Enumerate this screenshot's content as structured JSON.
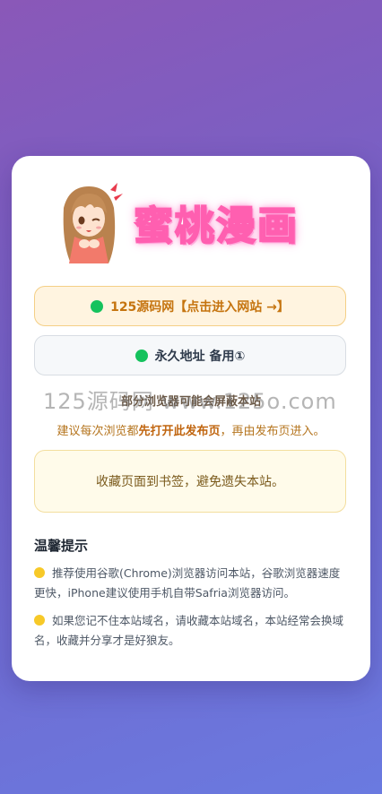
{
  "logo": {
    "title": "蜜桃漫画",
    "mascot_icon": "anime-girl-mascot-icon"
  },
  "buttons": {
    "primary_label": "125源码网【点击进入网站 →】",
    "secondary_label": "永久地址 备用①",
    "status_dot_color": "#15c25d"
  },
  "notice": {
    "line1": "部分浏览器可能会屏蔽本站",
    "line2_prefix": "建议每次浏览都",
    "line2_strong": "先打开此发布页",
    "line2_suffix": "，再由发布页进入。"
  },
  "bookmark_text": "收藏页面到书签，避免遗失本站。",
  "tips": {
    "title": "温馨提示",
    "items": [
      "推荐使用谷歌(Chrome)浏览器访问本站，谷歌浏览器速度更快，iPhone建议使用手机自带Safria浏览器访问。",
      "如果您记不住本站域名，请收藏本站域名，本站经常会换域名，收藏并分享才是好狼友。"
    ]
  },
  "watermark": "125源码网 www.125o.com",
  "colors": {
    "accent_orange": "#c5740f",
    "bulb_yellow": "#f7c928"
  }
}
